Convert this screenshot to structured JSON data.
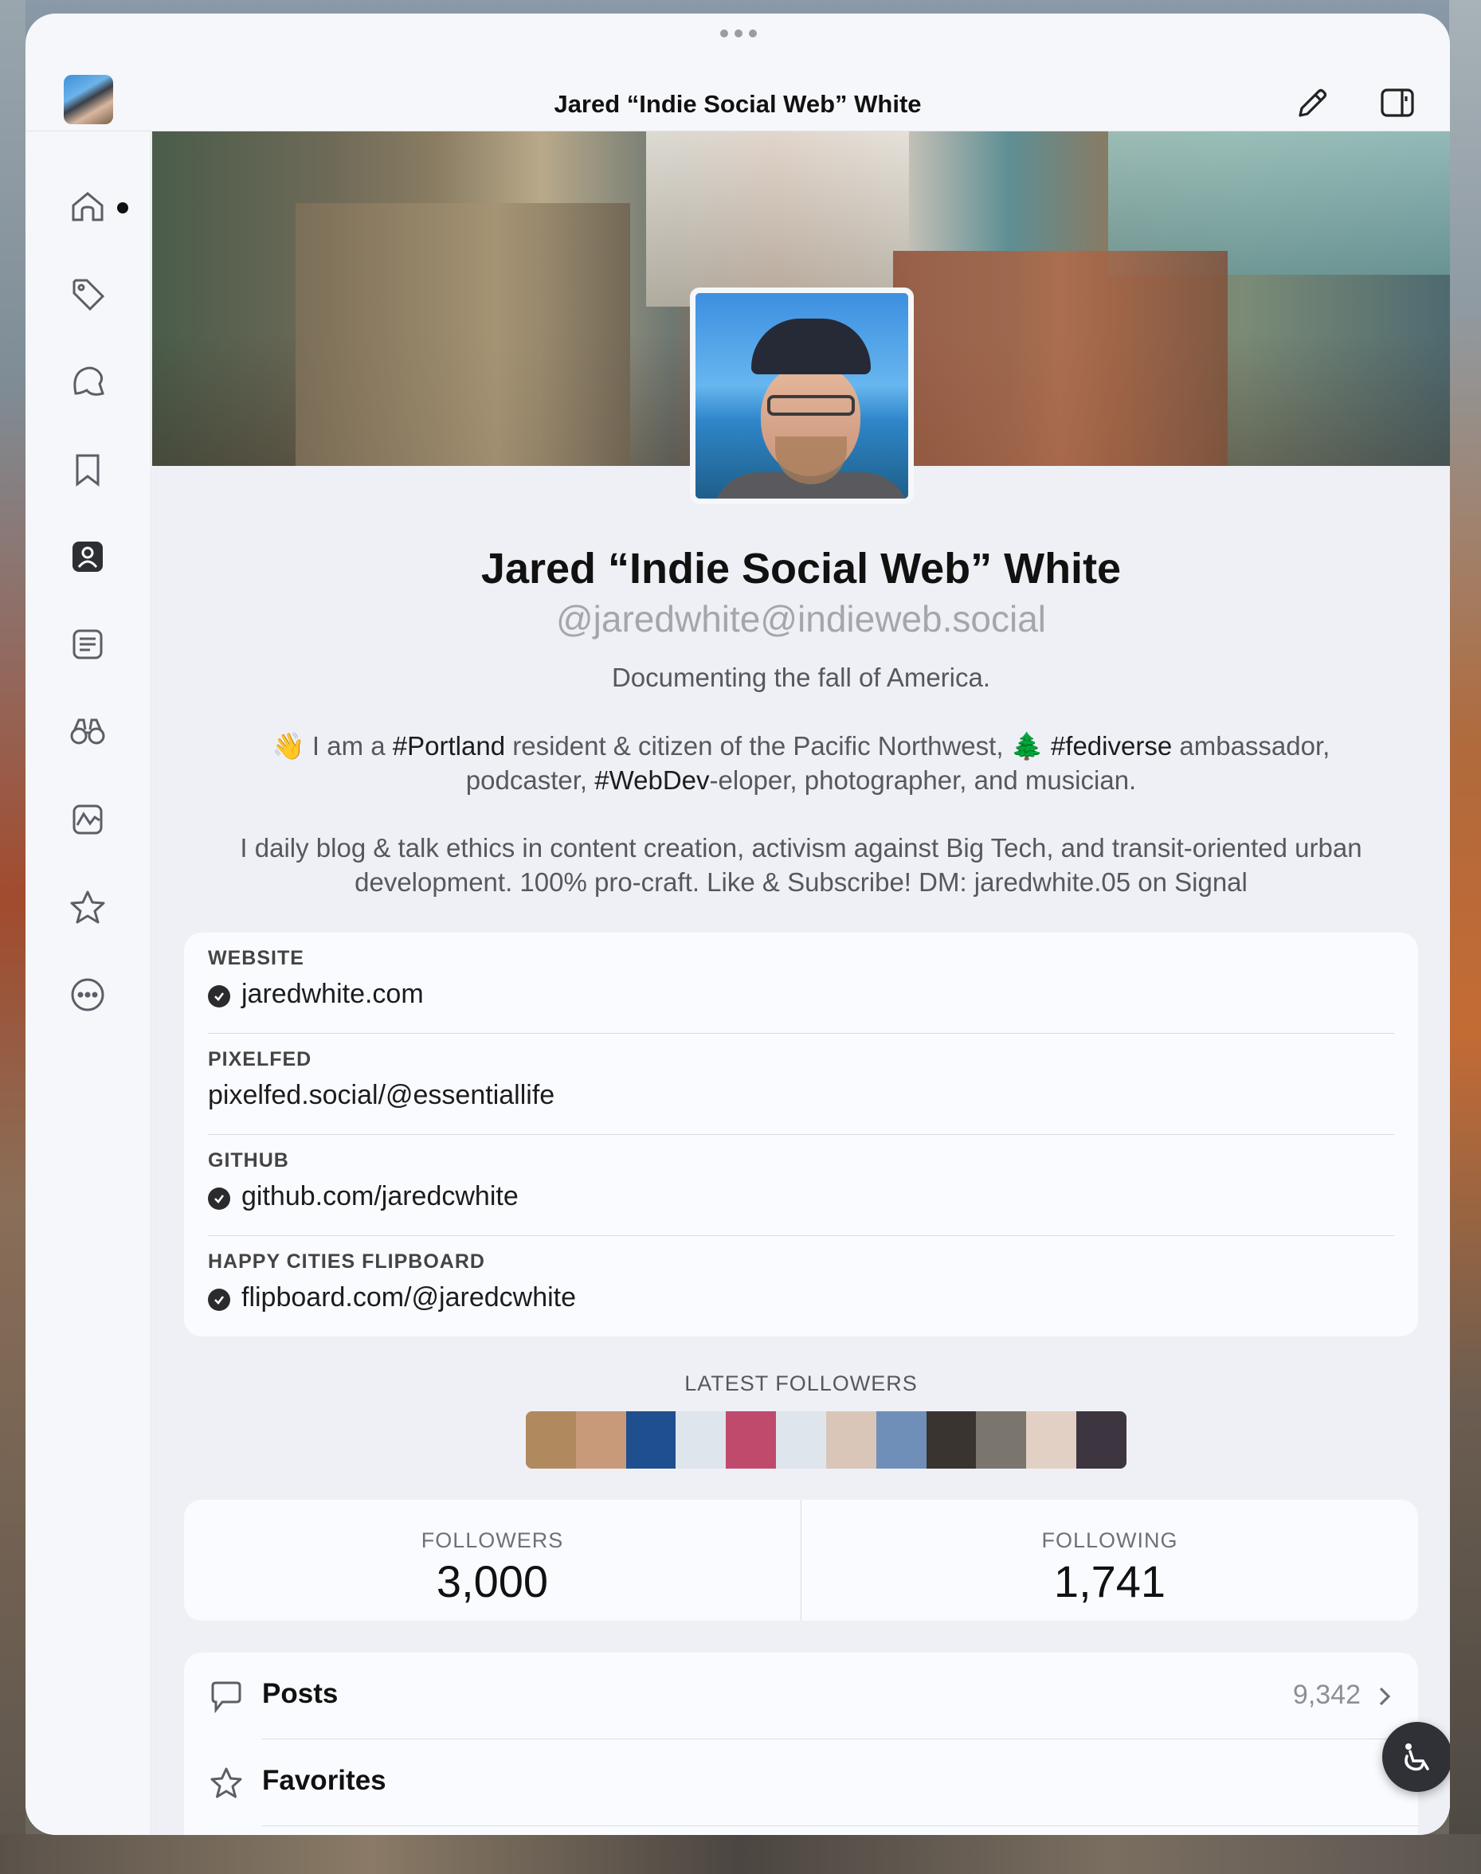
{
  "window": {
    "title": "Jared “Indie Social Web” White",
    "icons": {
      "account": "account-avatar",
      "compose": "pencil-icon",
      "sidebar_toggle": "sidebar-toggle-icon",
      "more": "more-dots-icon"
    }
  },
  "sidebar": {
    "items": [
      {
        "name": "home",
        "icon": "home-icon",
        "has_unread": true
      },
      {
        "name": "tags",
        "icon": "tag-icon"
      },
      {
        "name": "explore",
        "icon": "explore-icon"
      },
      {
        "name": "bookmarks",
        "icon": "bookmark-icon"
      },
      {
        "name": "profile",
        "icon": "profile-icon",
        "selected": true
      },
      {
        "name": "lists",
        "icon": "list-icon"
      },
      {
        "name": "discover",
        "icon": "binoculars-icon"
      },
      {
        "name": "activity",
        "icon": "activity-icon"
      },
      {
        "name": "favorites",
        "icon": "star-icon"
      },
      {
        "name": "more",
        "icon": "ellipsis-circle-icon"
      }
    ]
  },
  "profile": {
    "display_name": "Jared “Indie Social Web” White",
    "handle": "@jaredwhite@indieweb.social",
    "bio": {
      "line1": "Documenting the fall of America.",
      "p2_emoji1": "👋",
      "p2_t1": " I am a ",
      "p2_tag1": "#Portland",
      "p2_t2": " resident & citizen of the Pacific Northwest, ",
      "p2_emoji2": "🌲",
      "p2_tag2": " #fediverse",
      "p2_t3": " ambassador,",
      "p2_t4": "podcaster, ",
      "p2_tag3": "#WebDev",
      "p2_t5": "-eloper, photographer, and musician.",
      "p3_line1": "I daily blog & talk ethics in content creation, activism against Big Tech, and transit-oriented urban",
      "p3_line2": "development. 100% pro-craft. Like & Subscribe! DM: jaredwhite.05 on Signal"
    },
    "fields": [
      {
        "label": "WEBSITE",
        "value": "jaredwhite.com",
        "verified": true
      },
      {
        "label": "PIXELFED",
        "value": "pixelfed.social/@essentiallife",
        "verified": false
      },
      {
        "label": "GITHUB",
        "value": "github.com/jaredcwhite",
        "verified": true
      },
      {
        "label": "HAPPY CITIES FLIPBOARD",
        "value": "flipboard.com/@jaredcwhite",
        "verified": true
      }
    ],
    "latest_followers": {
      "label": "LATEST FOLLOWERS",
      "colors": [
        "#b08a5e",
        "#c99a7a",
        "#1f4f8f",
        "#dfe5ec",
        "#c04a6c",
        "#dfe5ec",
        "#d9c6b8",
        "#6f8fb8",
        "#3a3430",
        "#7a766e",
        "#e3d0c4",
        "#3d3540"
      ]
    },
    "stats": {
      "followers_label": "FOLLOWERS",
      "followers_value": "3,000",
      "following_label": "FOLLOWING",
      "following_value": "1,741"
    },
    "links": [
      {
        "label": "Posts",
        "count": "9,342",
        "icon": "speech-bubble-icon"
      },
      {
        "label": "Favorites",
        "count": "",
        "icon": "star-icon"
      }
    ]
  },
  "accessibility_button": {
    "icon": "accessibility-icon"
  }
}
